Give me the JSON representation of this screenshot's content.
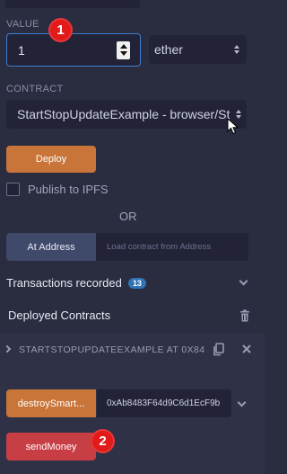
{
  "value_section": {
    "label": "VALUE",
    "amount": "1",
    "unit_selected": "ether"
  },
  "contract_section": {
    "label": "CONTRACT",
    "selected": "StartStopUpdateExample - browser/St"
  },
  "annotations": {
    "badge_one": "1",
    "badge_two": "2",
    "badge_color": "#e21a1a"
  },
  "deploy": {
    "button_label": "Deploy",
    "publish_label": "Publish to IPFS",
    "or_label": "OR"
  },
  "at_address": {
    "button_label": "At Address",
    "placeholder": "Load contract from Address"
  },
  "transactions": {
    "label": "Transactions recorded",
    "count": "13"
  },
  "deployed": {
    "label": "Deployed Contracts",
    "instance_title": "STARTSTOPUPDATEEXAMPLE AT 0X84",
    "functions": [
      {
        "label": "destroySmart...",
        "argument": "0xAb8483F64d9C6d1EcF9b"
      },
      {
        "label": "sendMoney"
      }
    ]
  },
  "colors": {
    "background": "#2a2c3f",
    "input_bg": "#222336",
    "deploy_orange": "#c97539",
    "send_red": "#c83e45",
    "focus_blue": "#3e7fd1",
    "at_address_bg": "#3f4a6a",
    "count_badge": "#2f75b6"
  },
  "icons": [
    "spinner-icon",
    "select-arrows-icon",
    "cursor-pointer-icon",
    "chevron-down-icon",
    "trash-icon",
    "chevron-right-icon",
    "copy-icon",
    "close-icon"
  ]
}
